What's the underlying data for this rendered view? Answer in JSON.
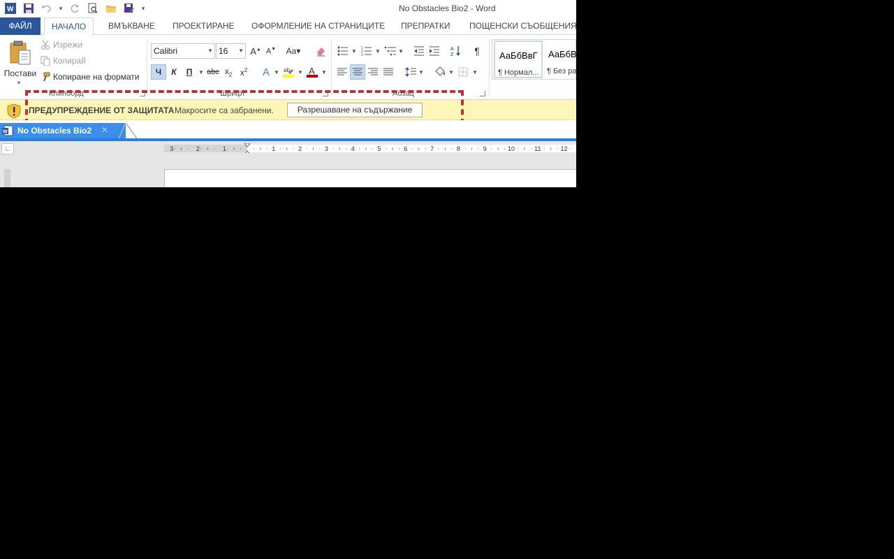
{
  "window": {
    "title": "No Obstacles Bio2 - Word"
  },
  "qat": {
    "icons": [
      "word-app-icon",
      "save-icon",
      "undo-icon",
      "redo-icon",
      "print-preview-icon",
      "open-folder-icon",
      "save-as-icon",
      "customize-qat-icon"
    ]
  },
  "ribbon_tabs": {
    "file": "ФАЙЛ",
    "home": "НАЧАЛО",
    "insert": "ВМЪКВАНЕ",
    "design": "ПРОЕКТИРАНЕ",
    "layout": "ОФОРМЛЕНИЕ НА СТРАНИЦИТЕ",
    "references": "ПРЕПРАТКИ",
    "mailings": "ПОЩЕНСКИ СЪОБЩЕНИЯ"
  },
  "clipboard": {
    "paste": "Постави",
    "cut": "Изрежи",
    "copy": "Копирай",
    "format_painter": "Копиране на формати",
    "group_label": "Клипборд"
  },
  "font": {
    "name": "Calibri",
    "size": "16",
    "bold": "Ч",
    "italic": "К",
    "underline": "П",
    "strike": "abc",
    "group_label": "Шрифт",
    "highlight_color": "#ffff00",
    "font_color": "#c00000"
  },
  "paragraph": {
    "group_label": "Абзац"
  },
  "styles": {
    "items": [
      {
        "sample": "АаБбВвГ",
        "name": "¶ Нормал..."
      },
      {
        "sample": "АаБбВ",
        "name": "¶ Без ра"
      }
    ]
  },
  "message_bar": {
    "title": "ПРЕДУПРЕЖДЕНИЕ ОТ ЗАЩИТАТА",
    "text": "Макросите са забранени.",
    "button": "Разрешаване на съдържание"
  },
  "document_tab": {
    "title": "No Obstacles Bio2"
  },
  "ruler": {
    "left_labels": [
      "3",
      "2",
      "1"
    ],
    "right_labels": [
      "1",
      "2",
      "3",
      "4",
      "5",
      "6",
      "7",
      "8",
      "9",
      "10",
      "11",
      "12"
    ]
  },
  "colors": {
    "accent": "#2b579a",
    "doc_tab": "#3c8fe8",
    "message_bar_bg": "#fcf7b6"
  }
}
